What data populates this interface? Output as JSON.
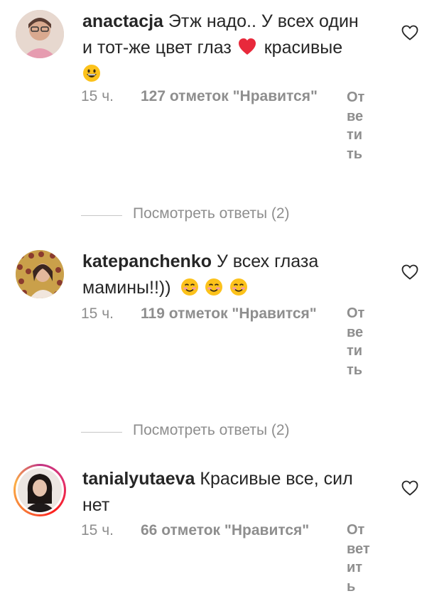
{
  "comments": [
    {
      "username": "anactacja",
      "text_line1": "Этж надо.. У всех один",
      "text_line2a": "и тот-же цвет глаз",
      "text_line2b": "красивые",
      "time": "15 ч.",
      "likes": "127 отметок \"Нравится\"",
      "reply": "Ответить",
      "view_replies": "Посмотреть ответы (2)",
      "emojis": [
        "red-heart",
        "grinning-face"
      ]
    },
    {
      "username": "katepanchenko",
      "text_line1": "У всех глаза",
      "text_line2": "мамины!!))",
      "time": "15 ч.",
      "likes": "119 отметок \"Нравится\"",
      "reply": "Ответить",
      "view_replies": "Посмотреть ответы (2)",
      "emojis": [
        "smiling-face",
        "smiling-face",
        "smiling-face"
      ]
    },
    {
      "username": "tanialyutaeva",
      "text_line1": "Красивые все, сил",
      "text_line2": "нет",
      "time": "15 ч.",
      "likes": "66 отметок \"Нравится\"",
      "reply": "Ответить",
      "has_story_ring": true
    }
  ],
  "colors": {
    "text": "#262626",
    "secondary": "#8e8e8e",
    "divider": "#c7c7c7"
  },
  "icons": {
    "like": "heart-outline-icon"
  }
}
